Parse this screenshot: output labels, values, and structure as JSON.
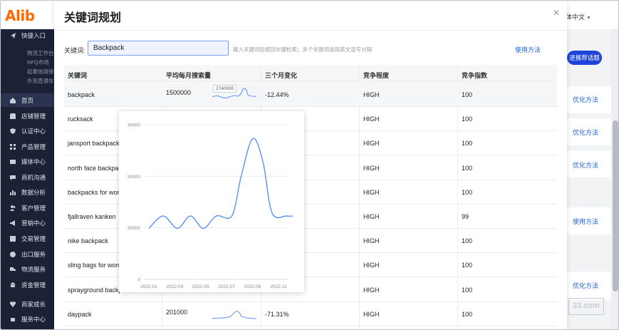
{
  "background": {
    "logo_text": "Alib",
    "language": "体中文",
    "sidebar": [
      {
        "label": "快捷入口",
        "icon": "send-icon"
      },
      {
        "label": "物流工作台",
        "sub": true
      },
      {
        "label": "RFQ市场",
        "sub": true
      },
      {
        "label": "起泰信用保障",
        "sub": true
      },
      {
        "label": "外贸直通车",
        "sub": true
      },
      {
        "label": "首页",
        "icon": "home-icon",
        "active": true
      },
      {
        "label": "店铺管理",
        "icon": "store-icon"
      },
      {
        "label": "认证中心",
        "icon": "shield-icon"
      },
      {
        "label": "产品管理",
        "icon": "grid-icon"
      },
      {
        "label": "媒体中心",
        "icon": "media-icon"
      },
      {
        "label": "商机沟通",
        "icon": "chat-icon"
      },
      {
        "label": "数据分析",
        "icon": "chart-icon"
      },
      {
        "label": "客户管理",
        "icon": "users-icon"
      },
      {
        "label": "营销中心",
        "icon": "megaphone-icon"
      },
      {
        "label": "交易管理",
        "icon": "trade-icon"
      },
      {
        "label": "出口服务",
        "icon": "globe-icon"
      },
      {
        "label": "物流服务",
        "icon": "truck-icon"
      },
      {
        "label": "资金管理",
        "icon": "bank-icon"
      },
      {
        "label": "商家成长",
        "icon": "heart-icon"
      },
      {
        "label": "服务中心",
        "icon": "service-icon"
      }
    ],
    "right_pill": "进推荐话题",
    "right_links": [
      "优化方法",
      "优化方法",
      "优化方法",
      "使用方法",
      "优化方法"
    ],
    "watermark": "23.com"
  },
  "modal": {
    "title": "关键词规划",
    "keyword_label": "关键词:",
    "keyword_value": "Backpack",
    "hint": "输入关键词后按回车键检索；多个关键词请用英文逗号分隔",
    "usage_link": "使用方法"
  },
  "table": {
    "headers": [
      "关键词",
      "平均每月搜索量",
      "三个月变化",
      "竞争程度",
      "竞争指数"
    ],
    "rows": [
      {
        "keyword": "backpack",
        "volume": "1500000",
        "change": "-12.44%",
        "competition": "HIGH",
        "index": "100",
        "spark_label": "2740000"
      },
      {
        "keyword": "rucksack",
        "volume": "",
        "change": "",
        "competition": "HIGH",
        "index": "100"
      },
      {
        "keyword": "jansport backpack",
        "volume": "",
        "change": "",
        "competition": "HIGH",
        "index": "100"
      },
      {
        "keyword": "north face backpack",
        "volume": "",
        "change": "",
        "competition": "HIGH",
        "index": "100"
      },
      {
        "keyword": "backpacks for wom",
        "volume": "",
        "change": "",
        "competition": "HIGH",
        "index": "100"
      },
      {
        "keyword": "fjallraven kanken",
        "volume": "",
        "change": "",
        "competition": "HIGH",
        "index": "99"
      },
      {
        "keyword": "nike backpack",
        "volume": "",
        "change": "",
        "competition": "HIGH",
        "index": "100"
      },
      {
        "keyword": "sling bags for wom",
        "volume": "",
        "change": "",
        "competition": "HIGH",
        "index": "100"
      },
      {
        "keyword": "sprayground backp",
        "volume": "",
        "change": "",
        "competition": "HIGH",
        "index": "100"
      },
      {
        "keyword": "daypack",
        "volume": "201000",
        "change": "-71.31%",
        "competition": "HIGH",
        "index": "100"
      }
    ]
  },
  "chart_data": {
    "type": "line",
    "title": "",
    "xlabel": "",
    "ylabel": "",
    "y_tick_labels": [
      "0",
      "30000",
      "30000",
      "30000"
    ],
    "x_tick_labels": [
      "2022-01",
      "2022-03",
      "2022-05",
      "2022-07",
      "2022-09",
      "2022-11"
    ],
    "grid": true,
    "series_color": "#5b8ff9",
    "points": [
      {
        "x": 0.0,
        "level": 0.33
      },
      {
        "x": 0.55,
        "level": 0.41
      },
      {
        "x": 1.1,
        "level": 0.33
      },
      {
        "x": 1.6,
        "level": 0.41
      },
      {
        "x": 2.1,
        "level": 0.33
      },
      {
        "x": 2.6,
        "level": 0.41
      },
      {
        "x": 3.2,
        "level": 0.41
      },
      {
        "x": 3.55,
        "level": 0.66
      },
      {
        "x": 4.0,
        "level": 0.91
      },
      {
        "x": 4.4,
        "level": 0.76
      },
      {
        "x": 4.75,
        "level": 0.43
      },
      {
        "x": 5.3,
        "level": 0.41
      },
      {
        "x": 5.55,
        "level": 0.41
      }
    ]
  }
}
